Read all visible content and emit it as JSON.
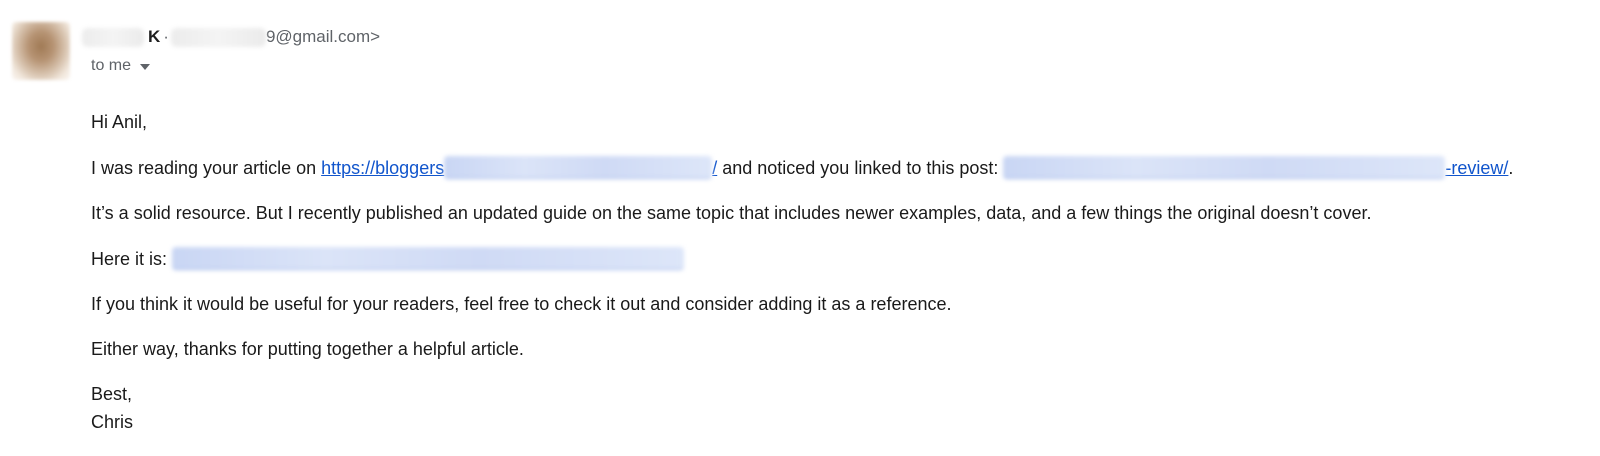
{
  "sender": {
    "name_suffix": "K",
    "separator": "·",
    "email_visible_suffix": "9@gmail.com>"
  },
  "recipient": {
    "label": "to me"
  },
  "message": {
    "greeting": "Hi Anil,",
    "p1": {
      "before_link1": "I was reading your article on ",
      "link1_visible": "https://bloggers",
      "link1_tail": "/",
      "middle": " and noticed you linked to this post: ",
      "link2_visible_end": "-review/",
      "end": "."
    },
    "p2": "It’s a solid resource. But I recently published an updated guide on the same topic that includes newer examples, data, and a few things the original doesn’t cover.",
    "p3_label": "Here it is: ",
    "p4": "If you think it would be useful for your readers, feel free to check it out and consider adding it as a reference.",
    "p5": "Either way, thanks for putting together a helpful article.",
    "signoff": "Best,",
    "signature": "Chris"
  },
  "colors": {
    "link": "#1155cc",
    "muted": "#5f6368",
    "text": "#1a1a1a"
  },
  "icons": {
    "recipient_dropdown": "caret-down-icon",
    "avatar": "sender-avatar"
  }
}
